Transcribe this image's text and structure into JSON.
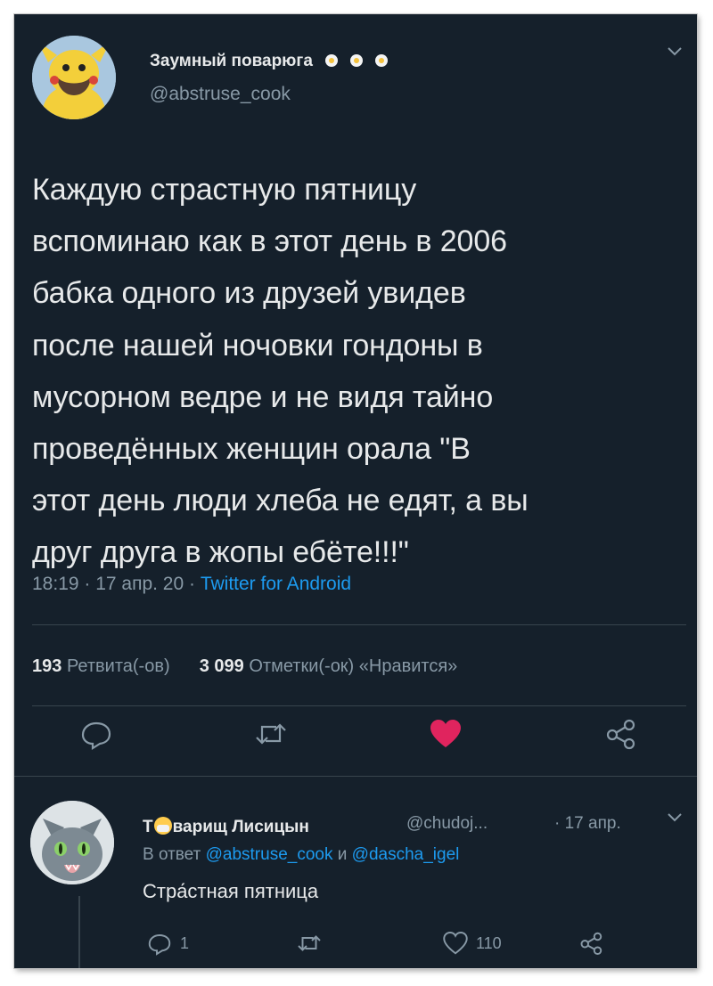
{
  "tweet": {
    "author_name": "Заумный поварюга",
    "author_handle": "@abstruse_cook",
    "text": "Каждую страстную пятницу\nвспоминаю как в этот день в 2006\nбабка одного из друзей увидев\nпосле нашей ночовки гондоны в\nмусорном ведре и не видя тайно\nпроведённых женщин орала \"В\nэтот день люди хлеба не едят, а вы\nдруг друга в жопы ебёте!!!\"",
    "time": "18:19 · 17 апр. 20 · ",
    "source": "Twitter for Android",
    "retweets_count": "193",
    "retweets_label": "Ретвита(-ов)",
    "likes_count": "3 099",
    "likes_label": "Отметки(-ок) «Нравится»",
    "icons": [
      "reply-icon",
      "retweet-icon",
      "heart-icon",
      "share-icon"
    ],
    "like_color": "#e0245e"
  },
  "reply": {
    "author_name_prefix": "Т",
    "author_name_suffix": "варищ Лисицын",
    "author_handle": "@chudoj...",
    "date": "· 17 апр.",
    "reply_to_prefix": "В ответ ",
    "reply_to_user1": "@abstruse_cook",
    "reply_to_and": " и ",
    "reply_to_user2": "@dascha_igel",
    "text": "Стра́стная пятница",
    "reply_count": "1",
    "like_count": "110"
  },
  "colors": {
    "background": "#15202b",
    "text": "#e7e9ea",
    "muted": "#8899a6",
    "accent": "#1d9bf0"
  }
}
